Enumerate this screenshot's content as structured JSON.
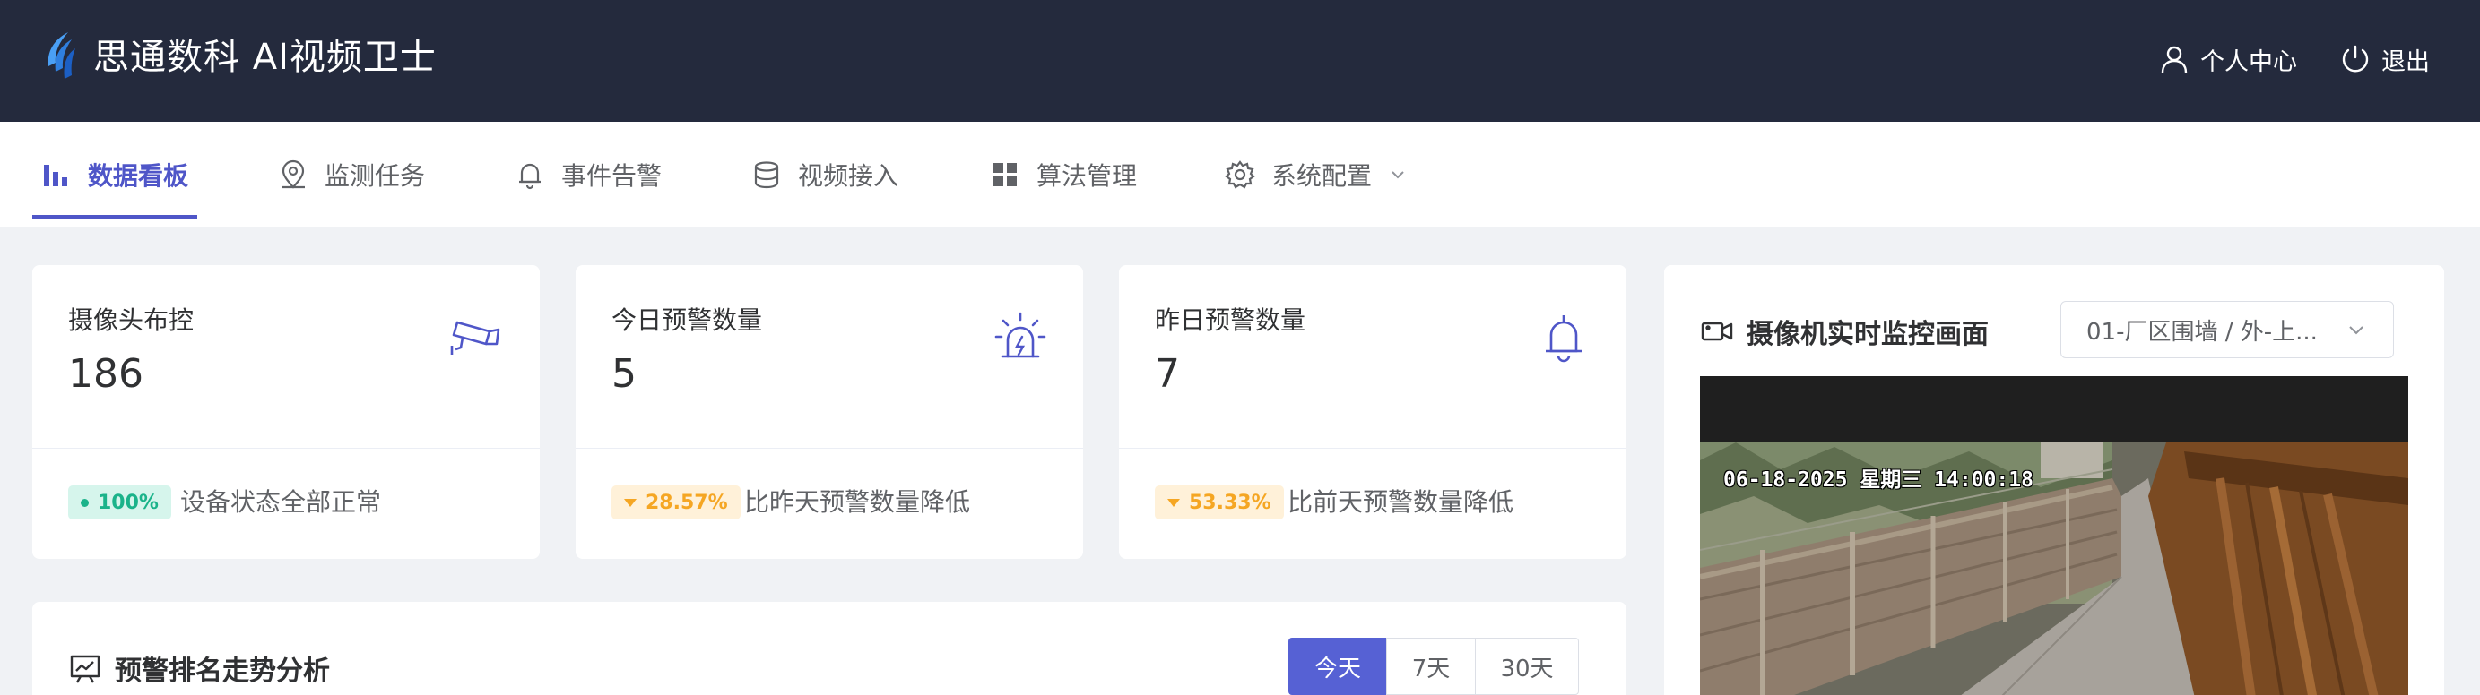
{
  "header": {
    "app_title": "思通数科 AI视频卫士",
    "profile_label": "个人中心",
    "logout_label": "退出"
  },
  "nav": {
    "items": [
      {
        "label": "数据看板",
        "icon": "bar-chart-icon",
        "active": true
      },
      {
        "label": "监测任务",
        "icon": "location-pin-icon"
      },
      {
        "label": "事件告警",
        "icon": "bell-icon"
      },
      {
        "label": "视频接入",
        "icon": "database-icon"
      },
      {
        "label": "算法管理",
        "icon": "grid-icon"
      },
      {
        "label": "系统配置",
        "icon": "gear-icon",
        "has_dropdown": true
      }
    ]
  },
  "stats": [
    {
      "label": "摄像头布控",
      "value": "186",
      "badge": "100%",
      "badge_style": "green",
      "note": "设备状态全部正常",
      "icon": "camera-icon"
    },
    {
      "label": "今日预警数量",
      "value": "5",
      "badge": "28.57%",
      "badge_style": "orange",
      "note": "比昨天预警数量降低",
      "icon": "alarm-light-icon"
    },
    {
      "label": "昨日预警数量",
      "value": "7",
      "badge": "53.33%",
      "badge_style": "orange",
      "note": "比前天预警数量降低",
      "icon": "bell-icon"
    }
  ],
  "trend": {
    "title": "预警排名走势分析",
    "ranges": [
      "今天",
      "7天",
      "30天"
    ],
    "active_range": "今天"
  },
  "camera": {
    "title": "摄像机实时监控画面",
    "selected": "01-厂区围墙 / 外-上...",
    "osd": "06-18-2025 星期三 14:00:18"
  },
  "colors": {
    "header_bg": "#242a3d",
    "accent": "#4f56c8",
    "success": "#1bb38a",
    "warning": "#f5a623"
  }
}
